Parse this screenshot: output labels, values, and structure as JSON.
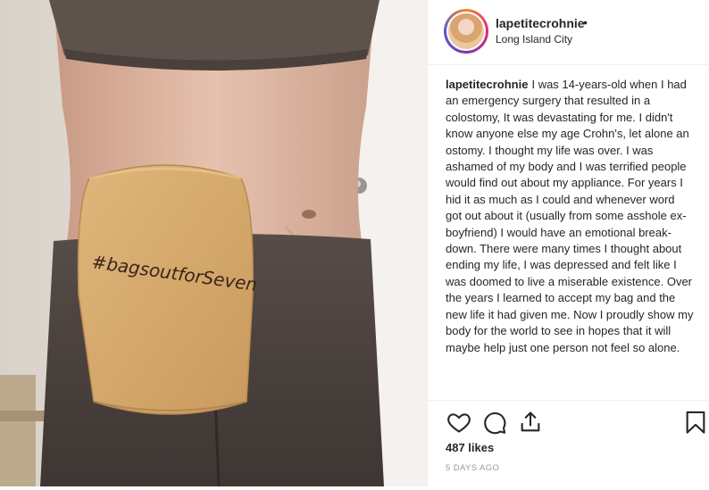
{
  "post": {
    "image": {
      "handwriting": "#bagsoutforSeven"
    },
    "header": {
      "username": "lapetitecrohnie",
      "separator": "•",
      "location": "Long Island City"
    },
    "caption": {
      "username": "lapetitecrohnie",
      "text": "I was 14-years-old when I had an emergency surgery that resulted in a colostomy, It was devastating for me. I didn't know anyone else my age Crohn's, let alone an ostomy. I thought my life was over. I was ashamed of my body and I was terrified people would find out about my appliance. For years I hid it as much as I could and whenever word got out about it (usually from some asshole ex-boyfriend) I would have an emotional break-down. There were many times I thought about ending my life, I was depressed and felt like I was doomed to live a miserable existence. Over the years I learned to accept my bag and the new life it had given me. Now I proudly show my body for the world to see in hopes that it will maybe help just one person not feel so alone."
    },
    "likes": "487 likes",
    "time": "5 DAYS AGO",
    "icons": {
      "like": "heart-icon",
      "comment": "comment-icon",
      "share": "share-icon",
      "save": "bookmark-icon"
    },
    "colors": {
      "ring": "#dd2a7b",
      "text": "#262626",
      "muted": "#999999"
    }
  }
}
